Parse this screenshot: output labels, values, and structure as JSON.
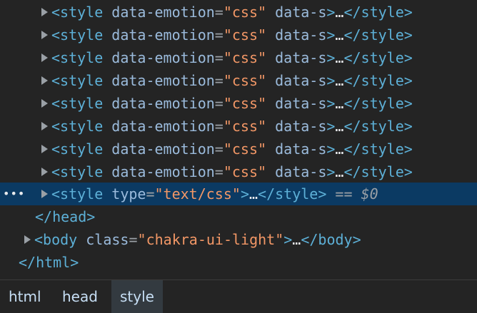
{
  "elements_tree": {
    "style_rows": [
      {
        "open": "<style",
        "attr1": "data-emotion",
        "eq": "=",
        "val1": "\"css\"",
        "attr2": "data-s",
        "close_start": ">",
        "ellipsis": "…",
        "end_tag": "</style>"
      },
      {
        "open": "<style",
        "attr1": "data-emotion",
        "eq": "=",
        "val1": "\"css\"",
        "attr2": "data-s",
        "close_start": ">",
        "ellipsis": "…",
        "end_tag": "</style>"
      },
      {
        "open": "<style",
        "attr1": "data-emotion",
        "eq": "=",
        "val1": "\"css\"",
        "attr2": "data-s",
        "close_start": ">",
        "ellipsis": "…",
        "end_tag": "</style>"
      },
      {
        "open": "<style",
        "attr1": "data-emotion",
        "eq": "=",
        "val1": "\"css\"",
        "attr2": "data-s",
        "close_start": ">",
        "ellipsis": "…",
        "end_tag": "</style>"
      },
      {
        "open": "<style",
        "attr1": "data-emotion",
        "eq": "=",
        "val1": "\"css\"",
        "attr2": "data-s",
        "close_start": ">",
        "ellipsis": "…",
        "end_tag": "</style>"
      },
      {
        "open": "<style",
        "attr1": "data-emotion",
        "eq": "=",
        "val1": "\"css\"",
        "attr2": "data-s",
        "close_start": ">",
        "ellipsis": "…",
        "end_tag": "</style>"
      },
      {
        "open": "<style",
        "attr1": "data-emotion",
        "eq": "=",
        "val1": "\"css\"",
        "attr2": "data-s",
        "close_start": ">",
        "ellipsis": "…",
        "end_tag": "</style>"
      },
      {
        "open": "<style",
        "attr1": "data-emotion",
        "eq": "=",
        "val1": "\"css\"",
        "attr2": "data-s",
        "close_start": ">",
        "ellipsis": "…",
        "end_tag": "</style>"
      }
    ],
    "selected_row": {
      "dots": "•••",
      "open": "<style",
      "attr": "type",
      "eq": "=",
      "val": "\"text/css\"",
      "close_start": ">",
      "ellipsis": "…",
      "end_tag": "</style>",
      "ref": "== $0"
    },
    "head_close": "</head>",
    "body_row": {
      "open": "<body",
      "attr": "class",
      "eq": "=",
      "val": "\"chakra-ui-light\"",
      "close_start": ">",
      "ellipsis": "…",
      "end_tag": "</body>"
    },
    "html_close": "</html>"
  },
  "breadcrumbs": [
    {
      "label": "html",
      "active": false
    },
    {
      "label": "head",
      "active": false
    },
    {
      "label": "style",
      "active": true
    }
  ],
  "colors": {
    "background": "#242424",
    "selected_row": "#0b3a63",
    "tag": "#5db0d7",
    "attribute": "#9bbbdc",
    "value": "#f29766"
  }
}
